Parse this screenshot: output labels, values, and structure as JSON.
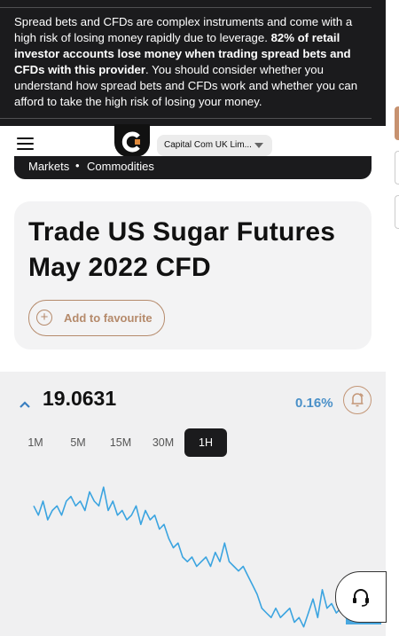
{
  "risk_warning": {
    "part1": "Spread bets and CFDs are complex instruments and come with a high risk of losing money rapidly due to leverage. ",
    "bold": "82% of retail investor accounts lose money when trading spread bets and CFDs with this provider",
    "part2": ". You should consider whether you understand how spread bets and CFDs work and whether you can afford to take the high risk of losing your money."
  },
  "header": {
    "entity_selector": "Capital Com UK Lim..."
  },
  "breadcrumb": {
    "items": [
      "Markets",
      "Commodities"
    ],
    "separator": "•"
  },
  "instrument": {
    "title": "Trade US Sugar Futures May 2022 CFD",
    "favourite_label": "Add to favourite"
  },
  "quote": {
    "price": "19.0631",
    "change": "0.16%",
    "direction": "up"
  },
  "timeframes": [
    {
      "label": "1M",
      "active": false
    },
    {
      "label": "5M",
      "active": false
    },
    {
      "label": "15M",
      "active": false
    },
    {
      "label": "30M",
      "active": false
    },
    {
      "label": "1H",
      "active": true
    }
  ],
  "colors": {
    "accent": "#b58a6b",
    "chart_line": "#3ba4e0",
    "dark": "#1b1b1d"
  },
  "chart_data": {
    "type": "line",
    "title": "",
    "xlabel": "",
    "ylabel": "",
    "series": [
      {
        "values": [
          19.24,
          19.22,
          19.25,
          19.21,
          19.23,
          19.24,
          19.22,
          19.25,
          19.26,
          19.24,
          19.25,
          19.23,
          19.27,
          19.25,
          19.24,
          19.28,
          19.23,
          19.25,
          19.22,
          19.23,
          19.21,
          19.22,
          19.24,
          19.2,
          19.23,
          19.21,
          19.22,
          19.19,
          19.2,
          19.17,
          19.15,
          19.16,
          19.13,
          19.12,
          19.13,
          19.11,
          19.12,
          19.13,
          19.11,
          19.14,
          19.12,
          19.16,
          19.12,
          19.11,
          19.1,
          19.11,
          19.09,
          19.07,
          19.05,
          19.02,
          19.01,
          19.0,
          19.02,
          19.0,
          19.01,
          19.02,
          18.99,
          19.0,
          18.98,
          19.01,
          19.04,
          19.0,
          19.06,
          19.02,
          19.03,
          19.01,
          19.02,
          19.0,
          19.01
        ]
      }
    ],
    "reference_line": 19.0631,
    "grid": false
  }
}
